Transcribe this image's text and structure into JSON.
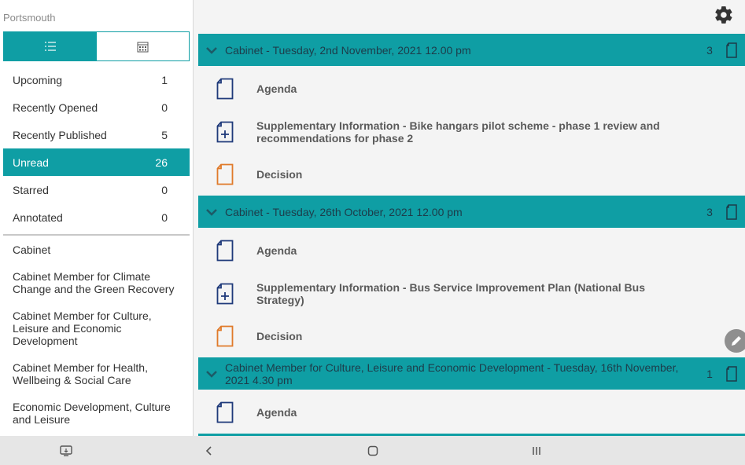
{
  "sidebar": {
    "org_name": "Portsmouth",
    "view_toggle": {
      "list_icon": "list-icon",
      "calendar_icon": "calendar-icon"
    },
    "filters": [
      {
        "label": "Upcoming",
        "count": "1"
      },
      {
        "label": "Recently Opened",
        "count": "0"
      },
      {
        "label": "Recently Published",
        "count": "5"
      },
      {
        "label": "Unread",
        "count": "26"
      },
      {
        "label": "Starred",
        "count": "0"
      },
      {
        "label": "Annotated",
        "count": "0"
      }
    ],
    "committees": [
      "Cabinet",
      "Cabinet Member for Climate Change and the Green Recovery",
      "Cabinet Member for Culture, Leisure and Economic Development",
      "Cabinet Member for Health, Wellbeing & Social Care",
      "Economic Development, Culture and Leisure"
    ]
  },
  "meetings": [
    {
      "title": "Cabinet - Tuesday, 2nd November, 2021 12.00 pm",
      "count": "3",
      "docs": [
        {
          "label": "Agenda",
          "icon": "document-icon"
        },
        {
          "label": "Supplementary Information - Bike hangars pilot scheme - phase 1 review and recommendations for phase 2",
          "icon": "document-plus-icon"
        },
        {
          "label": "Decision",
          "icon": "decision-document-icon"
        }
      ]
    },
    {
      "title": "Cabinet - Tuesday, 26th October, 2021 12.00 pm",
      "count": "3",
      "docs": [
        {
          "label": "Agenda",
          "icon": "document-icon"
        },
        {
          "label": "Supplementary Information - Bus Service Improvement Plan (National Bus Strategy)",
          "icon": "document-plus-icon"
        },
        {
          "label": "Decision",
          "icon": "decision-document-icon"
        }
      ]
    },
    {
      "title": "Cabinet Member for Culture, Leisure and Economic Development - Tuesday, 16th November, 2021 4.30 pm",
      "count": "1",
      "docs": [
        {
          "label": "Agenda",
          "icon": "document-icon"
        }
      ]
    }
  ],
  "colors": {
    "accent": "#0f9ea4",
    "doc_icon": "#1f3a7a",
    "decision_icon": "#e07a2a"
  }
}
